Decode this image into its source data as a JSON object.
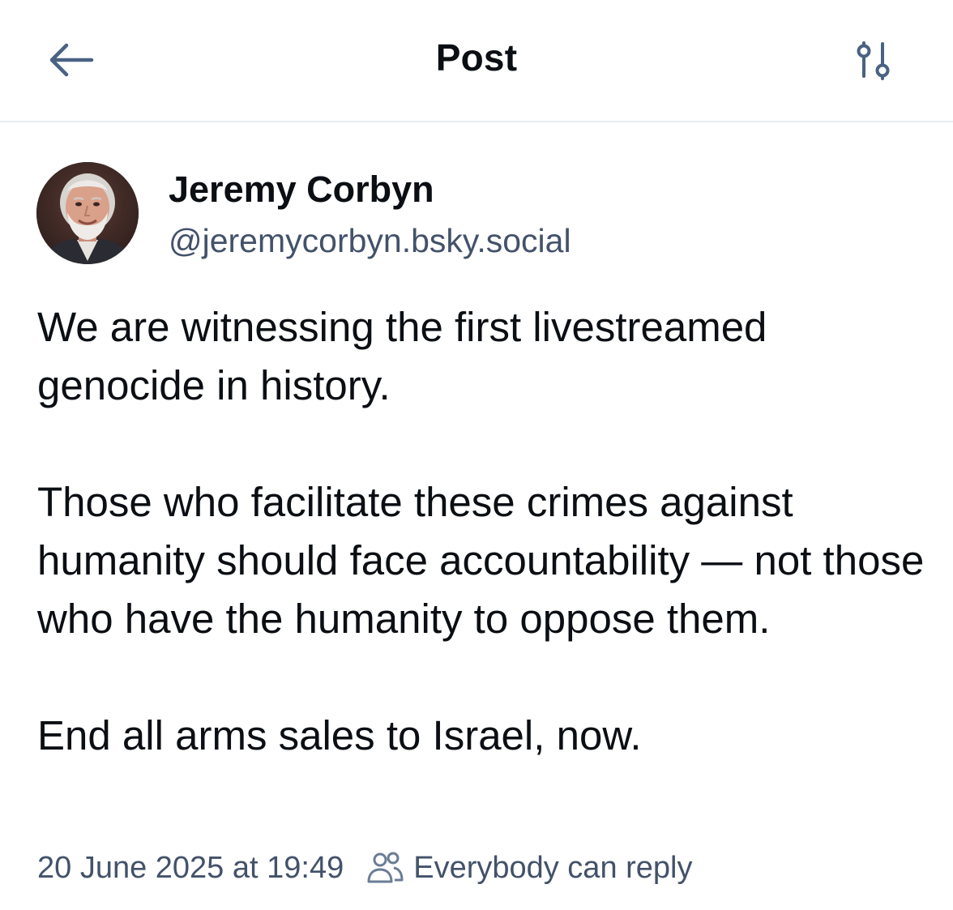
{
  "header": {
    "back_icon": "arrow-left-icon",
    "title": "Post",
    "settings_icon": "sliders-icon"
  },
  "author": {
    "avatar": "profile-photo",
    "name": "Jeremy Corbyn",
    "handle": "@jeremycorbyn.bsky.social"
  },
  "post": {
    "paragraphs": [
      "We are witnessing the first livestreamed genocide in history.",
      "Those who facilitate these crimes against humanity should face accountability — not those who have the humanity to oppose them.",
      "End all arms sales to Israel, now."
    ]
  },
  "meta": {
    "timestamp": "20 June 2025 at 19:49",
    "reply_icon": "people-icon",
    "reply_setting": "Everybody can reply"
  },
  "colors": {
    "text": "#0b0f14",
    "secondary_text": "#43526a",
    "icon": "#4a6282",
    "divider": "#e8ecf0"
  }
}
